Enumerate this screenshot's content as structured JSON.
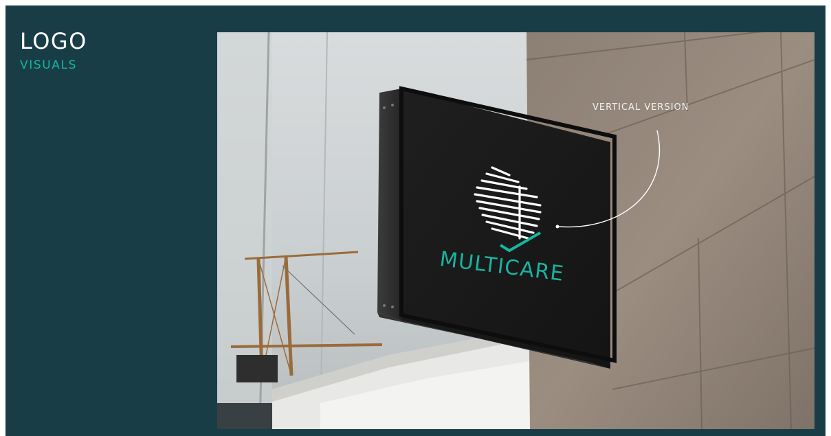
{
  "slide": {
    "title": "LOGO",
    "subtitle": "VISUALS"
  },
  "photo": {
    "annotation": "VERTICAL VERSION",
    "sign_brand": "MULTICARE"
  },
  "colors": {
    "background": "#193d46",
    "accent": "#16b5a0",
    "text": "#ffffff"
  }
}
